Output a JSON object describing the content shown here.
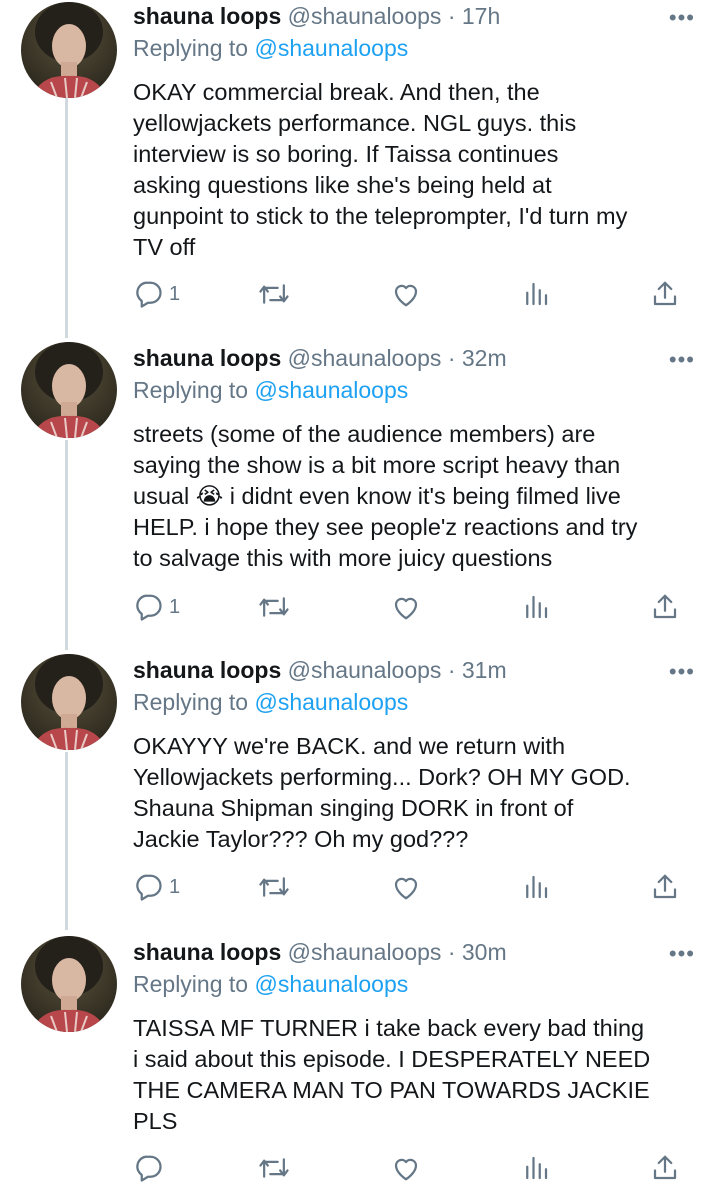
{
  "tweets": [
    {
      "name": "shauna loops",
      "handle": "@shaunaloops",
      "separator": "·",
      "time": "17h",
      "replying_prefix": "Replying to",
      "replying_handle": "@shaunaloops",
      "text": "OKAY commercial break. And then, the\nyellowjackets performance. NGL guys. this\ninterview is so boring. If Taissa continues\nasking questions like she's being held at\ngunpoint to stick to the teleprompter, I'd turn my\nTV off",
      "reply_count": "1"
    },
    {
      "name": "shauna loops",
      "handle": "@shaunaloops",
      "separator": "·",
      "time": "32m",
      "replying_prefix": "Replying to",
      "replying_handle": "@shaunaloops",
      "text": "streets (some of the audience members) are\nsaying the show is a bit more script heavy than\nusual 😭 i didnt even know it's being filmed live\nHELP. i hope they see people'z reactions and try\nto salvage this with more juicy questions",
      "reply_count": "1"
    },
    {
      "name": "shauna loops",
      "handle": "@shaunaloops",
      "separator": "·",
      "time": "31m",
      "replying_prefix": "Replying to",
      "replying_handle": "@shaunaloops",
      "text": "OKAYYY we're BACK. and we return with\nYellowjackets performing... Dork? OH MY GOD.\nShauna Shipman singing DORK in front of\nJackie Taylor??? Oh my god???",
      "reply_count": "1"
    },
    {
      "name": "shauna loops",
      "handle": "@shaunaloops",
      "separator": "·",
      "time": "30m",
      "replying_prefix": "Replying to",
      "replying_handle": "@shaunaloops",
      "text": "TAISSA MF TURNER i take back every bad thing\ni said about this episode. I DESPERATELY NEED\nTHE CAMERA MAN TO PAN TOWARDS JACKIE\nPLS",
      "reply_count": ""
    }
  ],
  "icons": {
    "more": "more-options-icon",
    "reply": "reply-icon",
    "retweet": "retweet-icon",
    "like": "like-icon",
    "analytics": "analytics-icon",
    "share": "share-icon"
  },
  "colors": {
    "link": "#1da1f2",
    "secondary_text": "#657786",
    "thread_line": "#cfd9de"
  }
}
